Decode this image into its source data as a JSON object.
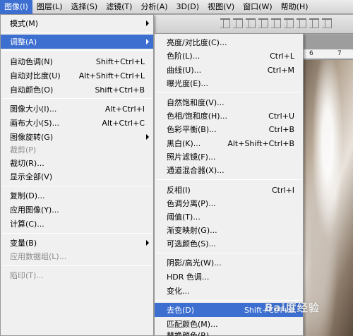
{
  "menubar": {
    "items": [
      "图像(I)",
      "图层(L)",
      "选择(S)",
      "滤镜(T)",
      "分析(A)",
      "3D(D)",
      "视图(V)",
      "窗口(W)",
      "帮助(H)"
    ]
  },
  "ruler": {
    "labels": [
      "6",
      "7"
    ]
  },
  "image_menu": {
    "items": [
      {
        "label": "模式(M)",
        "shortcut": ""
      },
      {
        "label": "调整(A)",
        "shortcut": ""
      },
      {
        "label": "自动色调(N)",
        "shortcut": "Shift+Ctrl+L"
      },
      {
        "label": "自动对比度(U)",
        "shortcut": "Alt+Shift+Ctrl+L"
      },
      {
        "label": "自动颜色(O)",
        "shortcut": "Shift+Ctrl+B"
      },
      {
        "label": "图像大小(I)...",
        "shortcut": "Alt+Ctrl+I"
      },
      {
        "label": "画布大小(S)...",
        "shortcut": "Alt+Ctrl+C"
      },
      {
        "label": "图像旋转(G)",
        "shortcut": ""
      },
      {
        "label": "裁剪(P)",
        "shortcut": ""
      },
      {
        "label": "裁切(R)...",
        "shortcut": ""
      },
      {
        "label": "显示全部(V)",
        "shortcut": ""
      },
      {
        "label": "复制(D)...",
        "shortcut": ""
      },
      {
        "label": "应用图像(Y)...",
        "shortcut": ""
      },
      {
        "label": "计算(C)...",
        "shortcut": ""
      },
      {
        "label": "变量(B)",
        "shortcut": ""
      },
      {
        "label": "应用数据组(L)...",
        "shortcut": ""
      },
      {
        "label": "陷印(T)...",
        "shortcut": ""
      }
    ]
  },
  "adjust_menu": {
    "items": [
      {
        "label": "亮度/对比度(C)...",
        "shortcut": ""
      },
      {
        "label": "色阶(L)...",
        "shortcut": "Ctrl+L"
      },
      {
        "label": "曲线(U)...",
        "shortcut": "Ctrl+M"
      },
      {
        "label": "曝光度(E)...",
        "shortcut": ""
      },
      {
        "label": "自然饱和度(V)...",
        "shortcut": ""
      },
      {
        "label": "色相/饱和度(H)...",
        "shortcut": "Ctrl+U"
      },
      {
        "label": "色彩平衡(B)...",
        "shortcut": "Ctrl+B"
      },
      {
        "label": "黑白(K)...",
        "shortcut": "Alt+Shift+Ctrl+B"
      },
      {
        "label": "照片滤镜(F)...",
        "shortcut": ""
      },
      {
        "label": "通道混合器(X)...",
        "shortcut": ""
      },
      {
        "label": "反相(I)",
        "shortcut": "Ctrl+I"
      },
      {
        "label": "色调分离(P)...",
        "shortcut": ""
      },
      {
        "label": "阈值(T)...",
        "shortcut": ""
      },
      {
        "label": "渐变映射(G)...",
        "shortcut": ""
      },
      {
        "label": "可选颜色(S)...",
        "shortcut": ""
      },
      {
        "label": "阴影/高光(W)...",
        "shortcut": ""
      },
      {
        "label": "HDR 色调...",
        "shortcut": ""
      },
      {
        "label": "变化...",
        "shortcut": ""
      },
      {
        "label": "去色(D)",
        "shortcut": "Shift+Ctrl+U"
      },
      {
        "label": "匹配颜色(M)...",
        "shortcut": ""
      },
      {
        "label": "替换颜色(R)...",
        "shortcut": ""
      }
    ]
  },
  "watermark": "Bai度经验"
}
